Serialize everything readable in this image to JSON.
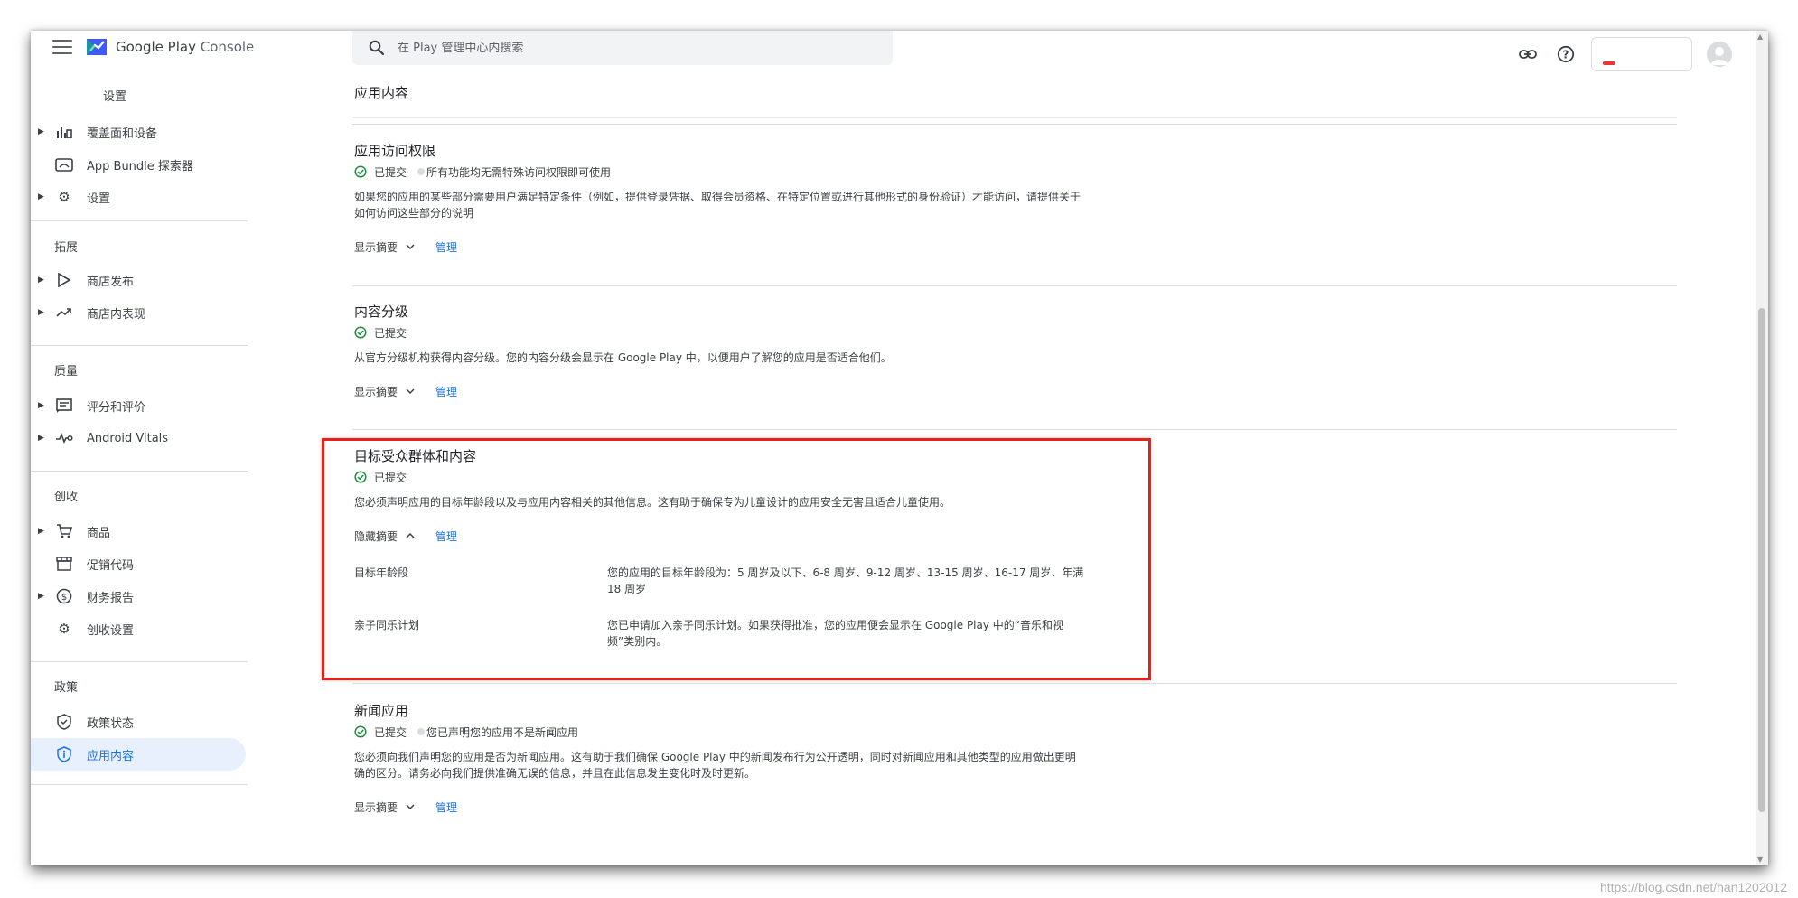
{
  "app": {
    "brand_main": "Google Play",
    "brand_sub": "Console",
    "top_breadcrumb": "设置"
  },
  "search": {
    "placeholder": "在 Play 管理中心内搜索"
  },
  "sidebar": {
    "items_group1": [
      {
        "label": "覆盖面和设备",
        "icon": "bar-chart-icon",
        "expandable": true
      },
      {
        "label": "App Bundle 探索器",
        "icon": "app-bundle-icon",
        "expandable": false
      },
      {
        "label": "设置",
        "icon": "gear-icon",
        "expandable": true
      }
    ],
    "section_grow": "拓展",
    "items_grow": [
      {
        "label": "商店发布",
        "icon": "play-icon",
        "expandable": true
      },
      {
        "label": "商店内表现",
        "icon": "trending-icon",
        "expandable": true
      }
    ],
    "section_quality": "质量",
    "items_quality": [
      {
        "label": "评分和评价",
        "icon": "reviews-icon",
        "expandable": true
      },
      {
        "label": "Android Vitals",
        "icon": "vitals-icon",
        "expandable": true
      }
    ],
    "section_monetize": "创收",
    "items_monetize": [
      {
        "label": "商品",
        "icon": "cart-icon",
        "expandable": true
      },
      {
        "label": "促销代码",
        "icon": "store-icon",
        "expandable": false
      },
      {
        "label": "财务报告",
        "icon": "dollar-icon",
        "expandable": true
      },
      {
        "label": "创收设置",
        "icon": "gear-icon",
        "expandable": false
      }
    ],
    "section_policy": "政策",
    "items_policy": [
      {
        "label": "政策状态",
        "icon": "shield-icon",
        "expandable": false
      },
      {
        "label": "应用内容",
        "icon": "info-icon",
        "expandable": false,
        "active": true
      }
    ]
  },
  "main": {
    "page_title": "应用内容",
    "sections": [
      {
        "title": "应用访问权限",
        "status": "已提交",
        "note": "所有功能均无需特殊访问权限即可使用",
        "description": "如果您的应用的某些部分需要用户满足特定条件（例如，提供登录凭据、取得会员资格、在特定位置或进行其他形式的身份验证）才能访问，请提供关于如何访问这些部分的说明",
        "toggle": "显示摘要",
        "manage": "管理"
      },
      {
        "title": "内容分级",
        "status": "已提交",
        "description": "从官方分级机构获得内容分级。您的内容分级会显示在 Google Play 中，以便用户了解您的应用是否适合他们。",
        "toggle": "显示摘要",
        "manage": "管理"
      },
      {
        "title": "目标受众群体和内容",
        "status": "已提交",
        "description": "您必须声明应用的目标年龄段以及与应用内容相关的其他信息。这有助于确保专为儿童设计的应用安全无害且适合儿童使用。",
        "toggle": "隐藏摘要",
        "manage": "管理",
        "summary": [
          {
            "key": "目标年龄段",
            "value": "您的应用的目标年龄段为：5 周岁及以下、6-8 周岁、9-12 周岁、13-15 周岁、16-17 周岁、年满 18 周岁"
          },
          {
            "key": "亲子同乐计划",
            "value": "您已申请加入亲子同乐计划。如果获得批准，您的应用便会显示在 Google Play 中的“音乐和视频”类别内。"
          }
        ]
      },
      {
        "title": "新闻应用",
        "status": "已提交",
        "note": "您已声明您的应用不是新闻应用",
        "description": "您必须向我们声明您的应用是否为新闻应用。这有助于我们确保 Google Play 中的新闻发布行为公开透明，同时对新闻应用和其他类型的应用做出更明确的区分。请务必向我们提供准确无误的信息，并且在此信息发生变化时及时更新。",
        "toggle": "显示摘要",
        "manage": "管理"
      }
    ]
  },
  "watermark": "https://blog.csdn.net/han1202012",
  "colors": {
    "accent": "#1a73e8",
    "success": "#1e8e3e",
    "highlight": "#e0241b"
  }
}
